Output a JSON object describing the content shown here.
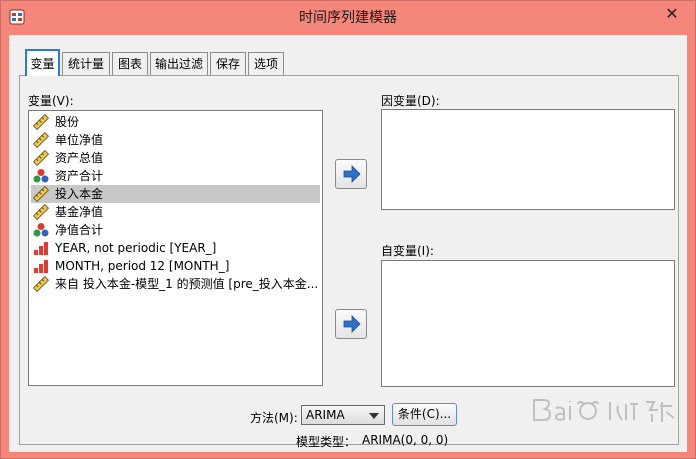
{
  "window": {
    "title": "时间序列建模器",
    "close_symbol": "✕"
  },
  "tabs": [
    {
      "label": "变量",
      "active": true
    },
    {
      "label": "统计量",
      "active": false
    },
    {
      "label": "图表",
      "active": false
    },
    {
      "label": "输出过滤",
      "active": false
    },
    {
      "label": "保存",
      "active": false
    },
    {
      "label": "选项",
      "active": false
    }
  ],
  "variables": {
    "label": "变量(V):",
    "items": [
      {
        "label": "股份",
        "icon": "scale-ruler-icon",
        "selected": false
      },
      {
        "label": "单位净值",
        "icon": "scale-ruler-icon",
        "selected": false
      },
      {
        "label": "资产总值",
        "icon": "scale-ruler-icon",
        "selected": false
      },
      {
        "label": "资产合计",
        "icon": "nominal-balls-icon",
        "selected": false
      },
      {
        "label": "投入本金",
        "icon": "scale-ruler-icon",
        "selected": true
      },
      {
        "label": "基金净值",
        "icon": "scale-ruler-icon",
        "selected": false
      },
      {
        "label": "净值合计",
        "icon": "nominal-balls-icon",
        "selected": false
      },
      {
        "label": "YEAR, not periodic [YEAR_]",
        "icon": "ordinal-bars-icon",
        "selected": false
      },
      {
        "label": "MONTH, period 12 [MONTH_]",
        "icon": "ordinal-bars-icon",
        "selected": false
      },
      {
        "label": "来自 投入本金-模型_1 的预测值 [pre_投入本金...",
        "icon": "scale-ruler-icon",
        "selected": false
      }
    ]
  },
  "dependent": {
    "label": "因变量(D):"
  },
  "independent": {
    "label": "自变量(I):"
  },
  "method": {
    "label": "方法(M):",
    "value": "ARIMA"
  },
  "criteria_button": {
    "label": "条件(C)..."
  },
  "model_type": {
    "label": "模型类型：",
    "value": "ARIMA(0, 0, 0)"
  },
  "colors": {
    "title_bar": "#f4877a",
    "active_tab_border": "#2b7bdc",
    "selection": "#c8c8c8",
    "arrow": "#2f6fc8"
  }
}
